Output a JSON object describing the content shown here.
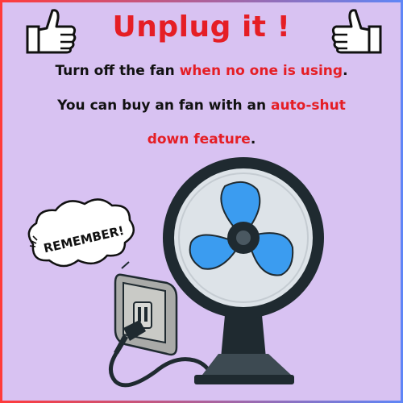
{
  "title": "Unplug it  !",
  "line1": {
    "part1": "Turn off the fan ",
    "highlight": "when no one is using",
    "end": "."
  },
  "line2": {
    "part1": "You can buy an fan with an ",
    "highlight": "auto-shut"
  },
  "line3": {
    "highlight": "down feature",
    "end": "."
  },
  "badge": "REMEMBER!",
  "icons": [
    "thumbs-up-icon",
    "thumbs-up-icon",
    "fan-icon",
    "wall-socket-icon",
    "plug-icon"
  ],
  "colors": {
    "background": "#d8c2f2",
    "accent": "#e51e25",
    "fan_blade": "#3b9cf0",
    "fan_guard": "#dde3e8",
    "dark": "#1f2a30"
  }
}
